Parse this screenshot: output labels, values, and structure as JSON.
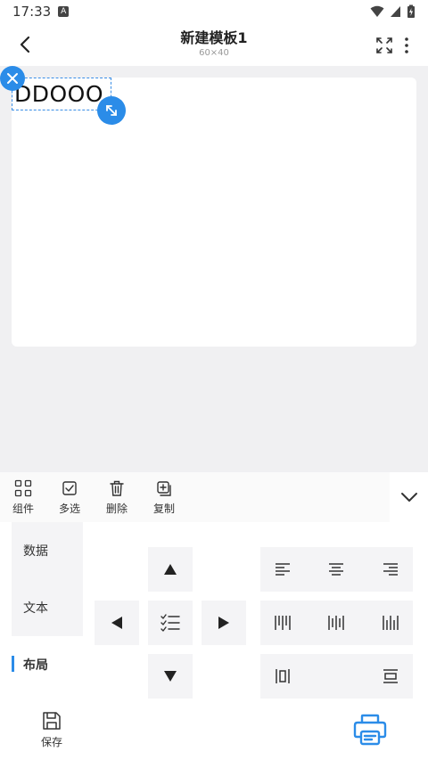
{
  "status": {
    "time": "17:33",
    "notif_letter": "A"
  },
  "header": {
    "title": "新建模板1",
    "subtitle": "60×40"
  },
  "canvas": {
    "element_text": "DDOOO"
  },
  "toolbar": {
    "components_label": "组件",
    "multiselect_label": "多选",
    "delete_label": "删除",
    "copy_label": "复制"
  },
  "side_nav": {
    "items": [
      "数据",
      "文本",
      "布局"
    ],
    "active_index": 2
  },
  "footer": {
    "save_label": "保存"
  },
  "colors": {
    "accent": "#2b8ce8",
    "panel_bg": "#f4f4f6"
  },
  "icons": [
    "back-arrow-icon",
    "fullscreen-icon",
    "more-vert-icon",
    "close-icon",
    "resize-icon",
    "components-icon",
    "checkbox-icon",
    "trash-icon",
    "copy-icon",
    "chevron-down-icon",
    "printer-icon",
    "save-icon"
  ]
}
